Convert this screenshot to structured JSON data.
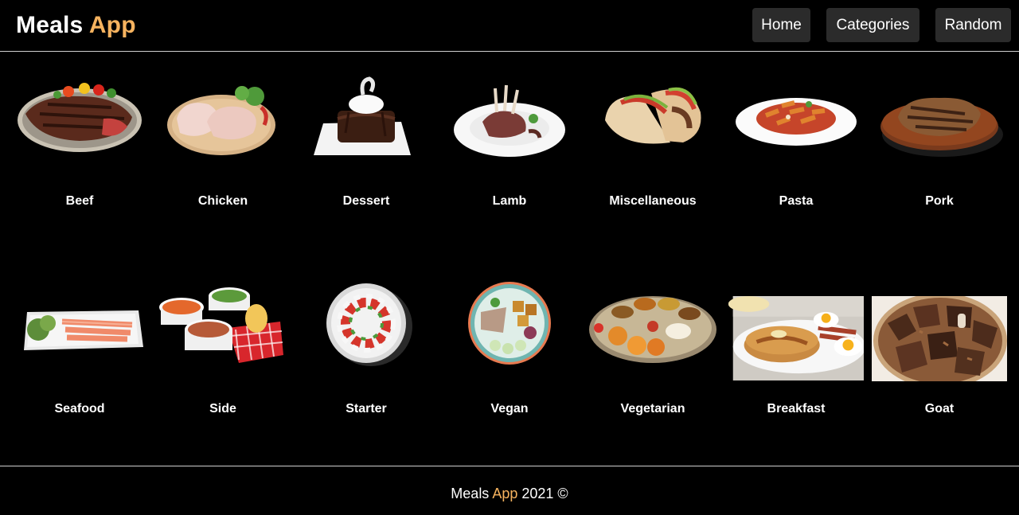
{
  "header": {
    "brand_main": "Meals",
    "brand_accent": "App",
    "nav": [
      {
        "label": "Home"
      },
      {
        "label": "Categories"
      },
      {
        "label": "Random"
      }
    ]
  },
  "categories": [
    {
      "label": "Beef",
      "icon": "beef-steak-image"
    },
    {
      "label": "Chicken",
      "icon": "chicken-legs-image"
    },
    {
      "label": "Dessert",
      "icon": "chocolate-dessert-image"
    },
    {
      "label": "Lamb",
      "icon": "lamb-chops-image"
    },
    {
      "label": "Miscellaneous",
      "icon": "tacos-image"
    },
    {
      "label": "Pasta",
      "icon": "penne-pasta-image"
    },
    {
      "label": "Pork",
      "icon": "pork-chop-image"
    },
    {
      "label": "Seafood",
      "icon": "salmon-plate-image"
    },
    {
      "label": "Side",
      "icon": "side-dishes-image"
    },
    {
      "label": "Starter",
      "icon": "caprese-starter-image"
    },
    {
      "label": "Vegan",
      "icon": "vegan-bowl-image"
    },
    {
      "label": "Vegetarian",
      "icon": "vegetarian-thali-image"
    },
    {
      "label": "Breakfast",
      "icon": "pancakes-breakfast-image"
    },
    {
      "label": "Goat",
      "icon": "goat-meat-image"
    }
  ],
  "footer": {
    "text_main": "Meals",
    "text_accent": "App",
    "year": "2021 ©"
  },
  "colors": {
    "accent": "#f6b35f",
    "background": "#000000",
    "button": "#2b2b2b"
  }
}
